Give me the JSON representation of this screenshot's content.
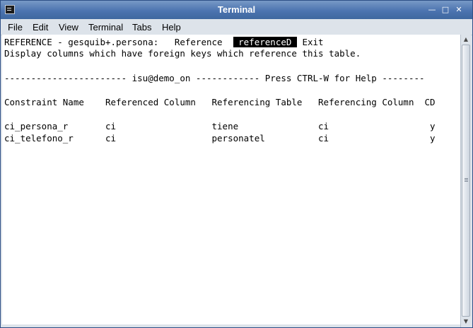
{
  "window": {
    "title": "Terminal",
    "controls": {
      "minimize": "—",
      "maximize": "□",
      "close": "✕"
    }
  },
  "menubar": {
    "items": [
      "File",
      "Edit",
      "View",
      "Terminal",
      "Tabs",
      "Help"
    ]
  },
  "terminal": {
    "line1_prefix": "REFERENCE - gesquib+.persona:   Reference  ",
    "line1_selected": " referenceD ",
    "line1_suffix": " Exit",
    "line2": "Display columns which have foreign keys which reference this table.",
    "separator": "----------------------- isu@demo_on ------------ Press CTRL-W for Help --------",
    "header": "Constraint Name    Referenced Column   Referencing Table   Referencing Column  CD",
    "rows": [
      "ci_persona_r       ci                  tiene               ci                   y",
      "ci_telefono_r      ci                  personatel          ci                   y"
    ]
  },
  "icons": {
    "app": "terminal-icon",
    "scroll_up": "arrow-up-icon",
    "scroll_down": "arrow-down-icon"
  },
  "colors": {
    "titlebar": "#4c74b0",
    "chrome": "#dde3ea",
    "terminal_bg": "#ffffff",
    "highlight_bg": "#000000"
  }
}
